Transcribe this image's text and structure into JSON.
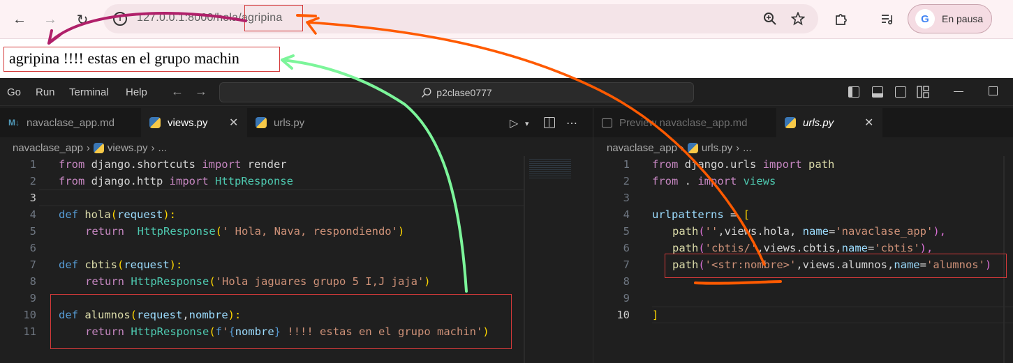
{
  "browser": {
    "back_label": "←",
    "forward_label": "→",
    "reload_label": "↻",
    "url": "127.0.0.1:8000/hola/agripina",
    "profile_status": "En pausa",
    "profile_badge": "G",
    "page_text": "agripina !!!! estas en el grupo machin"
  },
  "menubar": {
    "items": [
      "Go",
      "Run",
      "Terminal",
      "Help"
    ],
    "search": "p2clase0777"
  },
  "left_tabs": [
    {
      "icon": "markdown-icon",
      "label": "navaclase_app.md"
    },
    {
      "icon": "python-icon",
      "label": "views.py",
      "active": true
    },
    {
      "icon": "python-icon",
      "label": "urls.py"
    }
  ],
  "right_tabs": [
    {
      "icon": "preview-icon",
      "label": "Preview navaclase_app.md"
    },
    {
      "icon": "python-icon",
      "label": "urls.py",
      "active": true
    }
  ],
  "left_breadcrumb": {
    "folder": "navaclase_app",
    "file": "views.py",
    "rest": "..."
  },
  "right_breadcrumb": {
    "folder": "navaclase_app",
    "file": "urls.py",
    "rest": "..."
  },
  "views_code": {
    "line_numbers": [
      "1",
      "2",
      "3",
      "4",
      "5",
      "6",
      "7",
      "8",
      "9",
      "10",
      "11"
    ],
    "l1": {
      "a": "from",
      "b": " django.shortcuts ",
      "c": "import",
      "d": " render"
    },
    "l2": {
      "a": "from",
      "b": " django.http ",
      "c": "import",
      "d": " HttpResponse"
    },
    "l4": {
      "a": "def",
      "b": " hola",
      "c": "(",
      "d": "request",
      "e": "):"
    },
    "l5": {
      "a": "return",
      "b": "  HttpResponse",
      "c": "(",
      "d": "' Hola, Nava, respondiendo'",
      "e": ")"
    },
    "l7": {
      "a": "def",
      "b": " cbtis",
      "c": "(",
      "d": "request",
      "e": "):"
    },
    "l8": {
      "a": "return",
      "b": " HttpResponse",
      "c": "(",
      "d": "'Hola jaguares grupo 5 I,J jaja'",
      "e": ")"
    },
    "l10": {
      "a": "def",
      "b": " alumnos",
      "c": "(",
      "d": "request",
      "e": ",",
      "f": "nombre",
      "g": "):"
    },
    "l11": {
      "a": "return",
      "b": " HttpResponse",
      "c": "(",
      "d": "f",
      "e": "'",
      "f": "{",
      "g": "nombre",
      "h": "}",
      "i": " !!!! estas en el grupo machin'",
      "j": ")"
    }
  },
  "urls_code": {
    "line_numbers": [
      "1",
      "2",
      "3",
      "4",
      "5",
      "6",
      "7",
      "8",
      "9",
      "10"
    ],
    "l1": {
      "a": "from",
      "b": " django.urls ",
      "c": "import",
      "d": " path"
    },
    "l2": {
      "a": "from",
      "b": " . ",
      "c": "import",
      "d": " views"
    },
    "l4": {
      "a": "urlpatterns",
      "b": " = ",
      "c": "["
    },
    "l5": {
      "a": "path",
      "b": "(",
      "c": "''",
      "d": ",views.hola, ",
      "e": "name",
      "f": "=",
      "g": "'navaclase_app'",
      "h": "),"
    },
    "l6": {
      "a": "path",
      "b": "(",
      "c": "'cbtis/'",
      "d": ",views.cbtis,",
      "e": "name",
      "f": "=",
      "g": "'cbtis'",
      "h": "),"
    },
    "l7": {
      "a": "path",
      "b": "(",
      "c": "'<str:nombre>'",
      "d": ",views.alumnos,",
      "e": "name",
      "f": "=",
      "g": "'alumnos'",
      "h": ")"
    },
    "l10": {
      "a": "]"
    }
  },
  "colors": {
    "annotation_orange": "#ff5a00",
    "annotation_green": "#7cf59a",
    "annotation_purple": "#b0206a",
    "highlight_red": "#d43a3a"
  }
}
